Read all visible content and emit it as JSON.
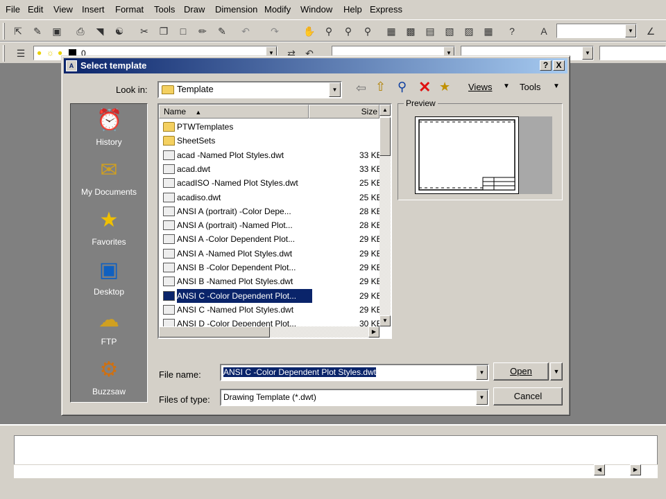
{
  "menubar": {
    "items": [
      "File",
      "Edit",
      "View",
      "Insert",
      "Format",
      "Tools",
      "Draw",
      "Dimension",
      "Modify",
      "Window",
      "Help",
      "Express"
    ]
  },
  "layer_toolbar": {
    "layer_value": "0"
  },
  "dialog": {
    "title": "Select template",
    "look_in_label": "Look in:",
    "look_in_value": "Template",
    "views_label": "Views",
    "tools_label": "Tools",
    "help_btn": "?",
    "close_btn": "X",
    "places": [
      {
        "label": "History",
        "icon": "history-icon"
      },
      {
        "label": "My Documents",
        "icon": "my-documents-icon"
      },
      {
        "label": "Favorites",
        "icon": "favorites-icon"
      },
      {
        "label": "Desktop",
        "icon": "desktop-icon"
      },
      {
        "label": "FTP",
        "icon": "ftp-icon"
      },
      {
        "label": "Buzzsaw",
        "icon": "buzzsaw-icon"
      }
    ],
    "columns": {
      "name": "Name",
      "size": "Size"
    },
    "files": [
      {
        "name": "PTWTemplates",
        "size": "",
        "type": "folder"
      },
      {
        "name": "SheetSets",
        "size": "",
        "type": "folder"
      },
      {
        "name": "acad -Named Plot Styles.dwt",
        "size": "33 KB",
        "type": "dwt"
      },
      {
        "name": "acad.dwt",
        "size": "33 KB",
        "type": "dwt"
      },
      {
        "name": "acadISO -Named Plot Styles.dwt",
        "size": "25 KB",
        "type": "dwt"
      },
      {
        "name": "acadiso.dwt",
        "size": "25 KB",
        "type": "dwt"
      },
      {
        "name": "ANSI A (portrait) -Color Depe...",
        "size": "28 KB",
        "type": "dwt"
      },
      {
        "name": "ANSI A (portrait) -Named Plot...",
        "size": "28 KB",
        "type": "dwt"
      },
      {
        "name": "ANSI A -Color Dependent Plot...",
        "size": "29 KB",
        "type": "dwt"
      },
      {
        "name": "ANSI A -Named Plot Styles.dwt",
        "size": "29 KB",
        "type": "dwt"
      },
      {
        "name": "ANSI B -Color Dependent Plot...",
        "size": "29 KB",
        "type": "dwt"
      },
      {
        "name": "ANSI B -Named Plot Styles.dwt",
        "size": "29 KB",
        "type": "dwt"
      },
      {
        "name": "ANSI C -Color Dependent Plot...",
        "size": "29 KB",
        "type": "dwt",
        "selected": true
      },
      {
        "name": "ANSI C -Named Plot Styles.dwt",
        "size": "29 KB",
        "type": "dwt"
      },
      {
        "name": "ANSI D -Color Dependent Plot...",
        "size": "30 KB",
        "type": "dwt"
      }
    ],
    "preview_label": "Preview",
    "file_name_label": "File name:",
    "file_name_value": "ANSI C -Color Dependent Plot Styles.dwt",
    "file_type_label": "Files of type:",
    "file_type_value": "Drawing Template (*.dwt)",
    "open_button": "Open",
    "cancel_button": "Cancel"
  },
  "colors": {
    "title_start": "#0a246a",
    "title_end": "#a6caf0",
    "selection": "#0a246a",
    "workspace": "#808080",
    "chrome": "#d4d0c8"
  }
}
